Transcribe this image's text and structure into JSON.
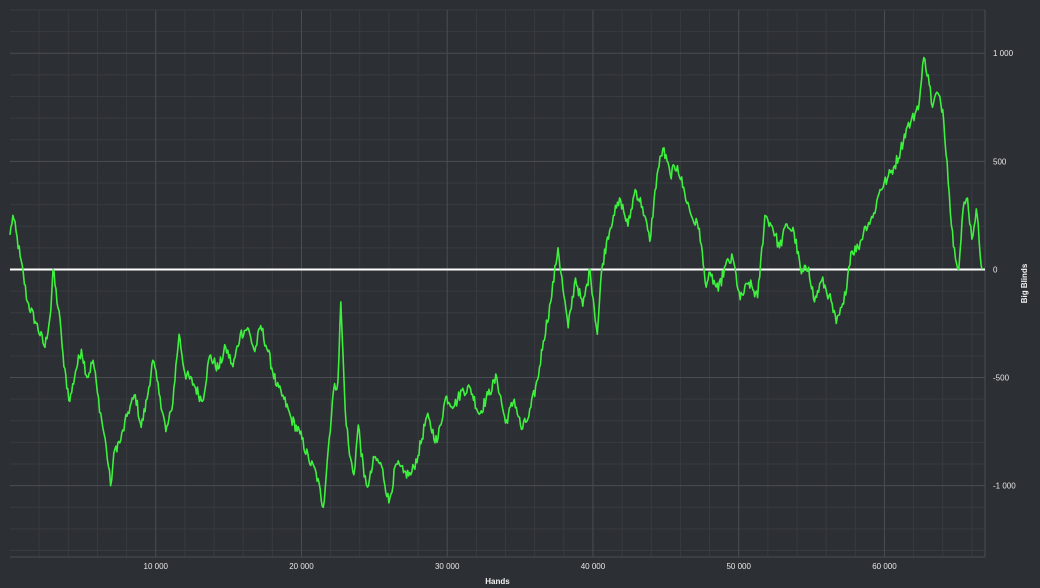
{
  "chart_data": {
    "type": "line",
    "title": "",
    "xlabel": "Hands",
    "ylabel": "Big Blinds",
    "xlim": [
      0,
      66900
    ],
    "ylim": [
      -1330,
      1200
    ],
    "x_ticks": [
      10000,
      20000,
      30000,
      40000,
      50000,
      60000
    ],
    "x_tick_labels": [
      "10 000",
      "20 000",
      "30 000",
      "40 000",
      "50 000",
      "60 000"
    ],
    "y_ticks": [
      1000,
      500,
      0,
      -500,
      -1000
    ],
    "y_tick_labels": [
      "1 000",
      "500",
      "0",
      "-500",
      "-1 000"
    ],
    "grid": true,
    "legend": "none",
    "colors": {
      "background": "#2c2f33",
      "series": "#3ef03e",
      "zero_line": "#ffffff",
      "grid": "#4a4e53",
      "text": "#e6e6e6"
    },
    "series": [
      {
        "x": [
          0,
          200,
          700,
          1200,
          1800,
          2400,
          2800,
          2950,
          3500,
          3700,
          4100,
          4500,
          4900,
          5300,
          5700,
          6000,
          6300,
          6600,
          6900,
          7200,
          7600,
          8100,
          8600,
          9000,
          9400,
          9800,
          10300,
          10700,
          11100,
          11600,
          12000,
          12600,
          13200,
          13700,
          14300,
          14800,
          15300,
          15800,
          16300,
          16800,
          17200,
          17700,
          18300,
          18800,
          19300,
          19900,
          20500,
          21000,
          21500,
          21900,
          22200,
          22500,
          22700,
          23000,
          23300,
          23600,
          23900,
          24300,
          24600,
          25000,
          25500,
          26000,
          26500,
          27000,
          27500,
          28000,
          28600,
          29300,
          29900,
          30500,
          31000,
          31600,
          32200,
          32800,
          33400,
          34000,
          34600,
          35100,
          35600,
          36200,
          36600,
          37100,
          37600,
          38000,
          38300,
          38800,
          39300,
          39800,
          40300,
          40600,
          41000,
          41400,
          41900,
          42400,
          42900,
          43400,
          43900,
          44400,
          44800,
          45300,
          45800,
          46300,
          46800,
          47300,
          47700,
          48100,
          48600,
          49100,
          49600,
          50100,
          50700,
          51300,
          51800,
          52300,
          52800,
          53300,
          53800,
          54300,
          54800,
          55200,
          55700,
          56200,
          56700,
          57200,
          57700,
          58200,
          58700,
          59200,
          59700,
          60200,
          60700,
          61100,
          61500,
          61800,
          62100,
          62400,
          62700,
          63000,
          63300,
          63600,
          64000,
          64300,
          64600,
          64800,
          65100,
          65400,
          65700,
          66000,
          66300,
          66700
        ],
        "y": [
          160,
          250,
          60,
          -150,
          -250,
          -360,
          -190,
          0,
          -280,
          -450,
          -610,
          -470,
          -370,
          -500,
          -420,
          -570,
          -700,
          -820,
          -1000,
          -830,
          -790,
          -660,
          -580,
          -730,
          -600,
          -420,
          -590,
          -750,
          -650,
          -300,
          -480,
          -530,
          -610,
          -400,
          -460,
          -360,
          -450,
          -300,
          -270,
          -380,
          -260,
          -380,
          -540,
          -600,
          -690,
          -760,
          -880,
          -940,
          -1100,
          -780,
          -560,
          -520,
          -150,
          -650,
          -860,
          -950,
          -720,
          -960,
          -1000,
          -870,
          -910,
          -1080,
          -900,
          -940,
          -950,
          -860,
          -680,
          -800,
          -590,
          -630,
          -560,
          -550,
          -670,
          -580,
          -500,
          -710,
          -600,
          -740,
          -680,
          -510,
          -330,
          -150,
          100,
          -120,
          -270,
          -40,
          -170,
          0,
          -300,
          0,
          150,
          250,
          320,
          200,
          370,
          290,
          130,
          440,
          560,
          440,
          480,
          350,
          240,
          190,
          -60,
          -30,
          -100,
          20,
          50,
          -140,
          -60,
          -130,
          250,
          200,
          100,
          210,
          170,
          -20,
          10,
          -150,
          -50,
          -120,
          -250,
          -160,
          80,
          100,
          200,
          240,
          370,
          420,
          480,
          550,
          650,
          680,
          720,
          780,
          980,
          900,
          750,
          820,
          740,
          500,
          200,
          100,
          0,
          280,
          330,
          140,
          280,
          0
        ]
      }
    ]
  }
}
